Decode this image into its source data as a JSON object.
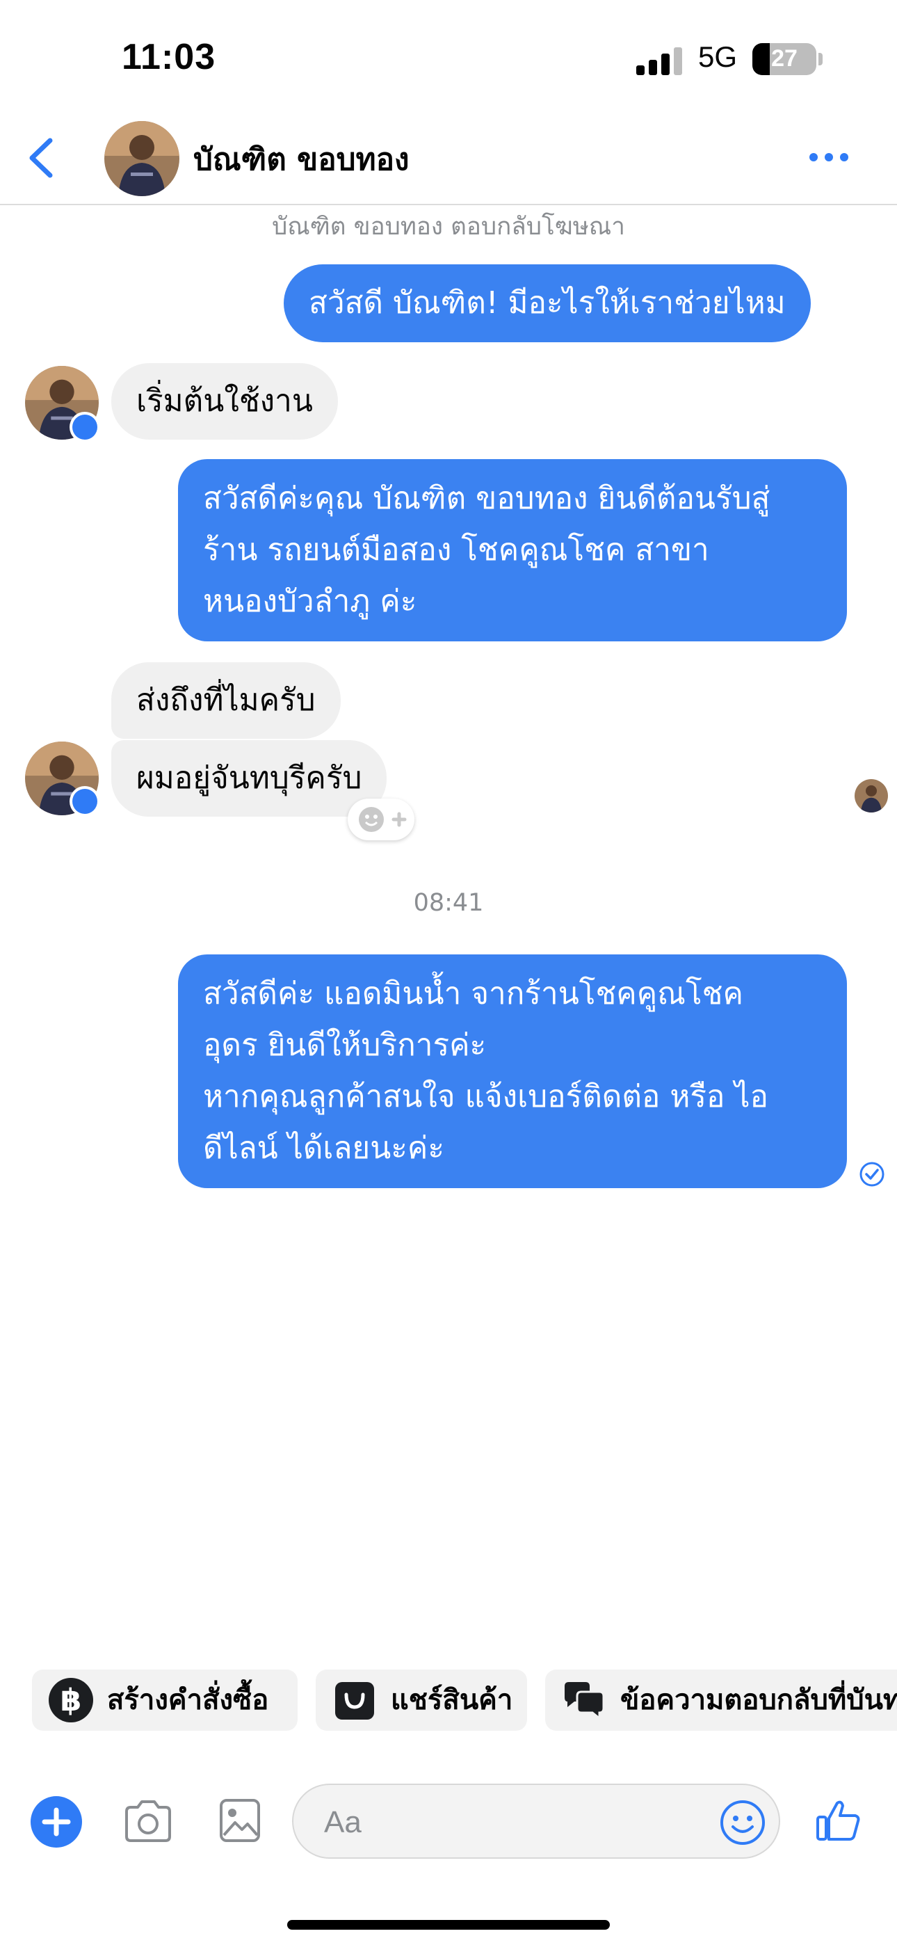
{
  "status_bar": {
    "time": "11:03",
    "network": "5G",
    "battery": "27",
    "battery_level": 0.27
  },
  "header": {
    "contact_name": "บัณฑิต ขอบทอง",
    "avatar": "profile-photo",
    "back_icon": "chevron-left-icon",
    "more_icon": "more-horizontal-icon"
  },
  "conversation": {
    "ad_reply_notice": "บัณฑิต ขอบทอง ตอบกลับโฆษณา",
    "messages": [
      {
        "direction": "outgoing",
        "lines": [
          "สวัสดี บัณฑิต! มีอะไรให้เราช่วยไหม"
        ]
      },
      {
        "direction": "incoming",
        "lines": [
          "เริ่มต้นใช้งาน"
        ]
      },
      {
        "direction": "outgoing",
        "lines": [
          "สวัสดีค่ะคุณ บัณฑิต ขอบทอง ยินดีต้อนรับสู่",
          "ร้าน รถยนต์มือสอง โชคคูณโชค สาขา",
          "หนองบัวลำภู ค่ะ"
        ]
      },
      {
        "direction": "incoming",
        "lines": [
          "ส่งถึงที่ไมครับ"
        ]
      },
      {
        "direction": "incoming",
        "lines": [
          "ผมอยู่จันทบุรีครับ"
        ]
      },
      {
        "direction": "outgoing",
        "lines": [
          "สวัสดีค่ะ แอดมินน้ำ จากร้านโชคคูณโชค",
          "อุดร ยินดีให้บริการค่ะ",
          "หากคุณลูกค้าสนใจ แจ้งเบอร์ติดต่อ หรือ ไอ",
          "ดีไลน์ ได้เลยนะค่ะ"
        ]
      }
    ],
    "timestamp": "08:41"
  },
  "quick_actions": [
    {
      "label": "สร้างคำสั่งซื้อ",
      "icon": "baht-icon"
    },
    {
      "label": "แชร์สินค้า",
      "icon": "shop-bag-icon"
    },
    {
      "label": "ข้อความตอบกลับที่บันท",
      "icon": "saved-replies-icon"
    }
  ],
  "composer": {
    "placeholder": "Aa",
    "icons": [
      "plus-icon",
      "camera-icon",
      "photo-icon",
      "emoji-icon",
      "thumbs-up-icon"
    ]
  },
  "colors": {
    "accent": "#2f7bf6",
    "outgoing_bubble": "#3b82f1",
    "incoming_bubble": "#f0f0f0",
    "meta_text": "#8a8d91"
  }
}
